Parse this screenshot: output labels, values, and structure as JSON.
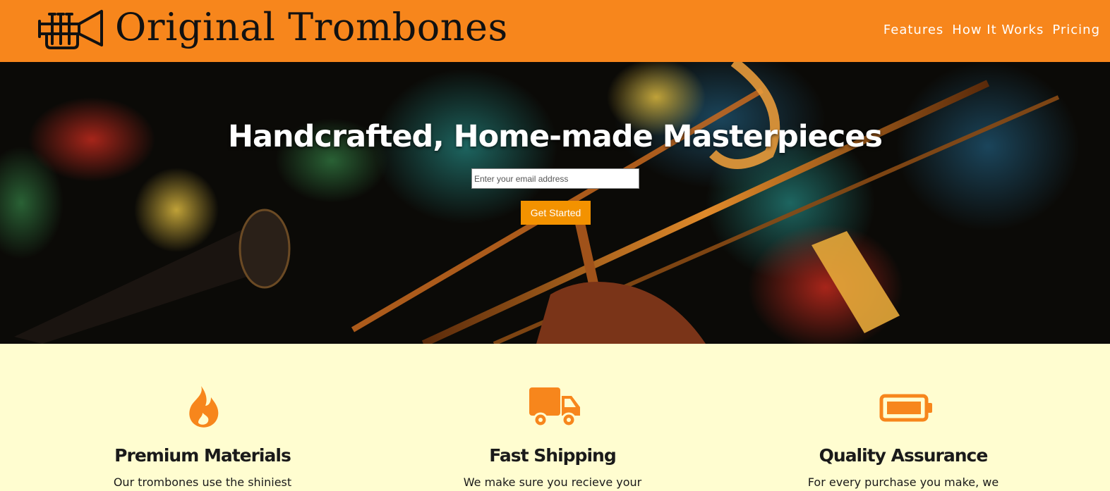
{
  "header": {
    "brand": "Original Trombones",
    "logo_icon": "trumpet-icon",
    "nav": [
      {
        "label": "Features"
      },
      {
        "label": "How It Works"
      },
      {
        "label": "Pricing"
      }
    ]
  },
  "hero": {
    "title": "Handcrafted, Home-made Masterpieces",
    "email_placeholder": "Enter your email address",
    "email_value": "",
    "cta_label": "Get Started",
    "background": "trombone-player-photo"
  },
  "features": [
    {
      "icon": "flame-icon",
      "title": "Premium Materials",
      "text": "Our trombones use the shiniest"
    },
    {
      "icon": "truck-icon",
      "title": "Fast Shipping",
      "text": "We make sure you recieve your"
    },
    {
      "icon": "battery-icon",
      "title": "Quality Assurance",
      "text": "For every purchase you make, we"
    }
  ],
  "colors": {
    "header_bg": "#f7861c",
    "accent": "#f39200",
    "icon": "#f7861c",
    "features_bg": "#fffdd0",
    "text_dark": "#1a1a1a"
  }
}
